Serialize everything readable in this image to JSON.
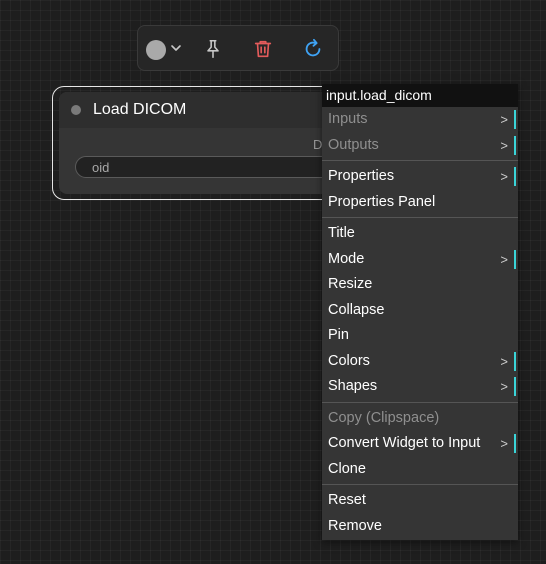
{
  "toolbar": {
    "color_swatch": "#a9a9a9",
    "icons": [
      "color-swatch",
      "chevron-down-icon",
      "pin-icon",
      "trash-icon",
      "refresh-icon"
    ],
    "trash_color": "#e35b5b",
    "refresh_color": "#3fa3f4"
  },
  "node": {
    "title": "Load DICOM",
    "output_label": "D",
    "widget_value": "oid"
  },
  "context_menu": {
    "title": "input.load_dicom",
    "groups": [
      [
        {
          "label": "Inputs",
          "disabled": true,
          "submenu": true
        },
        {
          "label": "Outputs",
          "disabled": true,
          "submenu": true
        }
      ],
      [
        {
          "label": "Properties",
          "disabled": false,
          "submenu": true
        },
        {
          "label": "Properties Panel",
          "disabled": false,
          "submenu": false
        }
      ],
      [
        {
          "label": "Title",
          "disabled": false,
          "submenu": false
        },
        {
          "label": "Mode",
          "disabled": false,
          "submenu": true
        },
        {
          "label": "Resize",
          "disabled": false,
          "submenu": false
        },
        {
          "label": "Collapse",
          "disabled": false,
          "submenu": false
        },
        {
          "label": "Pin",
          "disabled": false,
          "submenu": false
        },
        {
          "label": "Colors",
          "disabled": false,
          "submenu": true
        },
        {
          "label": "Shapes",
          "disabled": false,
          "submenu": true
        }
      ],
      [
        {
          "label": "Copy (Clipspace)",
          "disabled": true,
          "submenu": false
        },
        {
          "label": "Convert Widget to Input",
          "disabled": false,
          "submenu": true
        },
        {
          "label": "Clone",
          "disabled": false,
          "submenu": false
        }
      ],
      [
        {
          "label": "Reset",
          "disabled": false,
          "submenu": false
        },
        {
          "label": "Remove",
          "disabled": false,
          "submenu": false
        }
      ]
    ],
    "submenu_arrow": ">",
    "accent_color": "#3ad4d8"
  }
}
